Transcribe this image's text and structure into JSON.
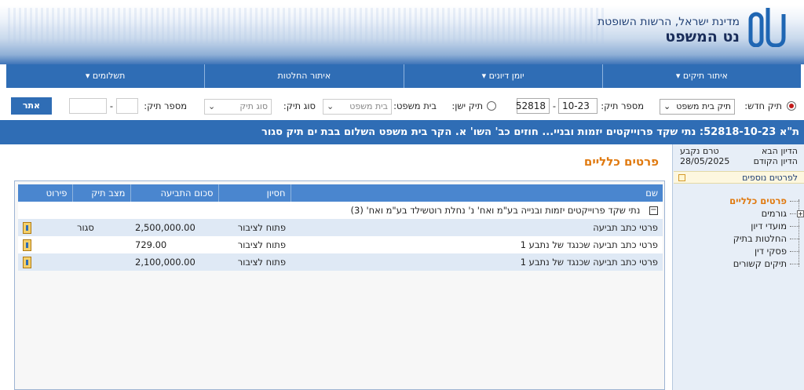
{
  "header": {
    "org_line": "מדינת ישראל, הרשות השופטת",
    "system_name": "נט המשפט"
  },
  "nav": {
    "items": [
      {
        "label": "איתור תיקים ▾"
      },
      {
        "label": "יומן דיונים ▾"
      },
      {
        "label": "איתור החלטות"
      },
      {
        "label": "תשלומים ▾"
      }
    ]
  },
  "search": {
    "new_case_label": "תיק חדש:",
    "new_case_select": "תיק בית משפט",
    "case_number_label": "מספר תיק:",
    "case_number_part1": "52818",
    "case_number_part2": "10-23",
    "old_case_label": "תיק ישן:",
    "court_label": "בית משפט:",
    "court_select": "בית משפט",
    "case_type_label": "סוג תיק:",
    "case_type_select": "סוג תיק",
    "old_number_label": "מספר תיק:",
    "old_number_part1": "",
    "old_number_sep": "-",
    "old_number_part2": "",
    "go_button": "אתר"
  },
  "case_title": "ת\"א 52818-10-23: נתי שקד פרוייקטים יזמות ובניי... חוזים כב' השו' א. הקר בית משפט השלום בבת ים תיק סגור",
  "sidebar": {
    "next_hearing_label": "הדיון הבא",
    "next_hearing_value": "טרם נקבע",
    "prev_hearing_label": "הדיון הקודם",
    "prev_hearing_value": "28/05/2025",
    "more_details": "לפרטים נוספים",
    "tree": [
      {
        "label": "פרטים כלליים"
      },
      {
        "label": "גורמים"
      },
      {
        "label": "מועדי דיון"
      },
      {
        "label": "החלטות בתיק"
      },
      {
        "label": "פסקי דין"
      },
      {
        "label": "תיקים קשורים"
      }
    ]
  },
  "main": {
    "section_title": "פרטים כלליים",
    "columns": [
      "שם",
      "חסיון",
      "סכום התביעה",
      "מצב תיק",
      "פירוט"
    ],
    "group_label": "נתי שקד פרוייקטים יזמות ובנייה בע\"מ ואח' נ' נחלת רוטשילד בע\"מ ואח' (3)",
    "rows": [
      {
        "name": "פרטי כתב תביעה",
        "privacy": "פתוח לציבור",
        "amount": "2,500,000.00",
        "status": "סגור"
      },
      {
        "name": "פרטי כתב תביעה שכנגד של נתבע 1",
        "privacy": "פתוח לציבור",
        "amount": "729.00",
        "status": ""
      },
      {
        "name": "פרטי כתב תביעה שכנגד של נתבע 1",
        "privacy": "פתוח לציבור",
        "amount": "2,100,000.00",
        "status": ""
      }
    ]
  }
}
